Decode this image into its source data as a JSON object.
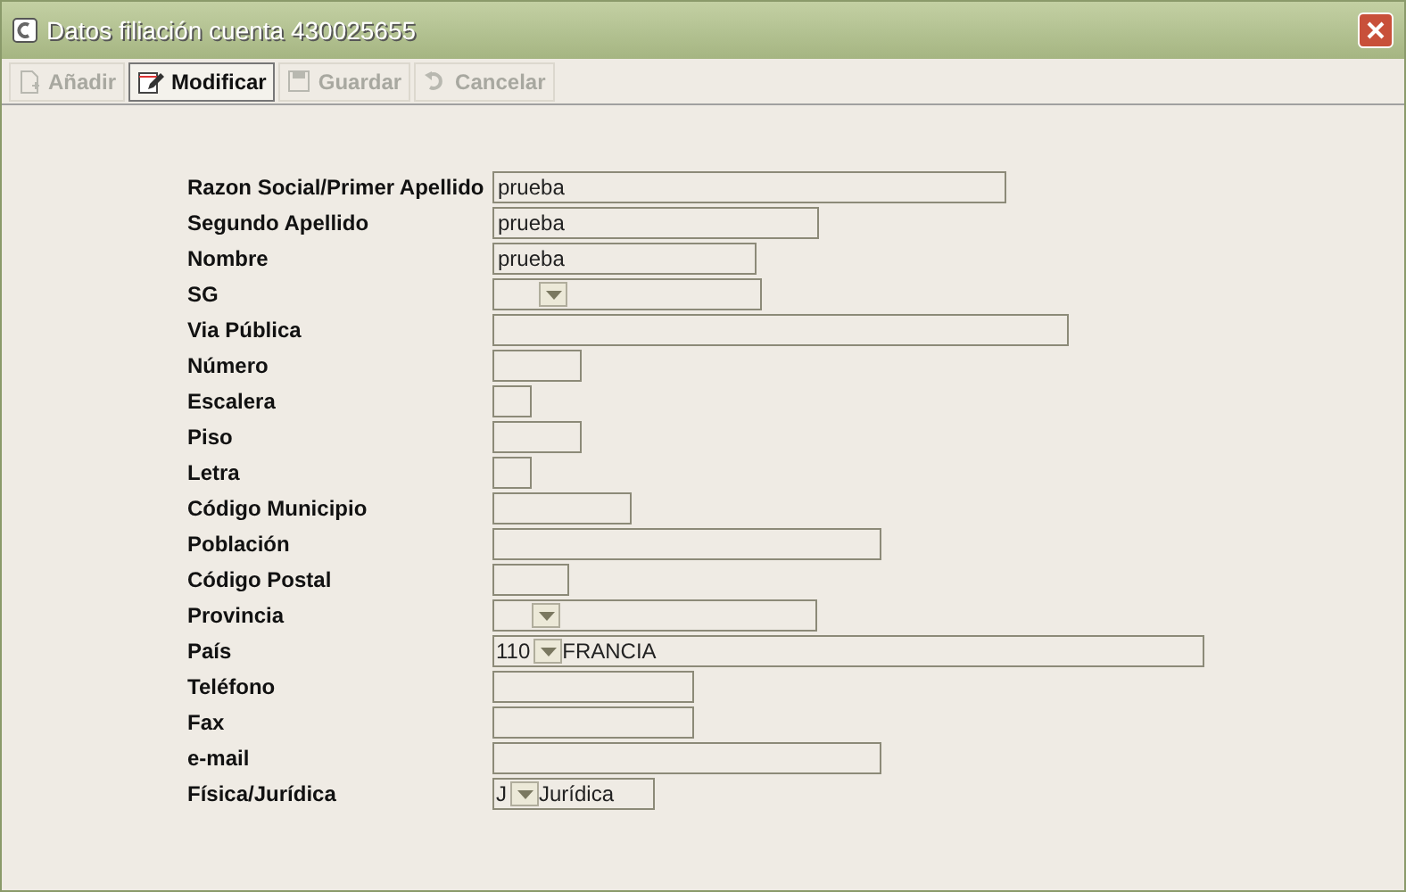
{
  "window": {
    "title": "Datos filiación cuenta 430025655"
  },
  "toolbar": [
    {
      "label": "Añadir",
      "kind": "add",
      "disabled": true,
      "selected": false
    },
    {
      "label": "Modificar",
      "kind": "edit",
      "disabled": false,
      "selected": true
    },
    {
      "label": "Guardar",
      "kind": "save",
      "disabled": true,
      "selected": false
    },
    {
      "label": "Cancelar",
      "kind": "undo",
      "disabled": true,
      "selected": false
    }
  ],
  "fields": [
    {
      "label": "Razon Social/Primer Apellido",
      "kind": "text",
      "value": "prueba"
    },
    {
      "label": "Segundo Apellido",
      "kind": "text",
      "value": "prueba"
    },
    {
      "label": "Nombre",
      "kind": "text",
      "value": "prueba"
    },
    {
      "label": "SG",
      "kind": "combo"
    },
    {
      "label": "Via Pública",
      "kind": "text"
    },
    {
      "label": "Número",
      "kind": "text"
    },
    {
      "label": "Escalera",
      "kind": "text"
    },
    {
      "label": "Piso",
      "kind": "text"
    },
    {
      "label": "Letra",
      "kind": "text"
    },
    {
      "label": "Código Municipio",
      "kind": "text"
    },
    {
      "label": "Población",
      "kind": "text"
    },
    {
      "label": "Código Postal",
      "kind": "text"
    },
    {
      "label": "Provincia",
      "kind": "combo"
    },
    {
      "label": "País",
      "kind": "combo",
      "code": "110",
      "description": "FRANCIA"
    },
    {
      "label": "Teléfono",
      "kind": "text"
    },
    {
      "label": "Fax",
      "kind": "text"
    },
    {
      "label": "e-mail",
      "kind": "text"
    },
    {
      "label": "Física/Jurídica",
      "kind": "combo",
      "code": "J",
      "description": "Jurídica"
    }
  ]
}
